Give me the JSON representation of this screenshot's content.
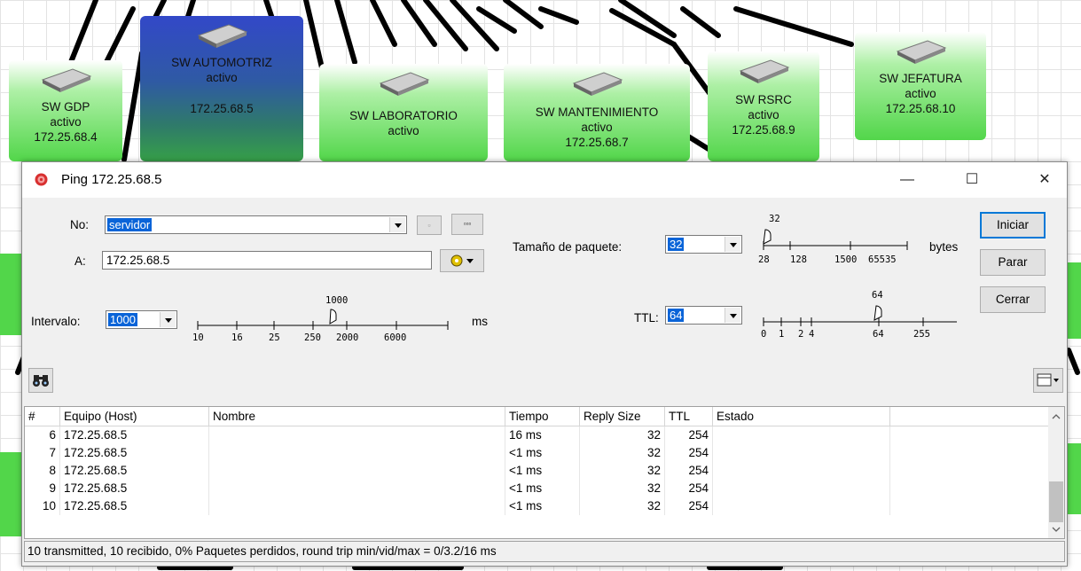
{
  "map": {
    "nodes": [
      {
        "id": "gdp",
        "name": "SW GDP",
        "status": "activo",
        "ip": "172.25.68.4",
        "selected": false
      },
      {
        "id": "automotriz",
        "name": "SW AUTOMOTRIZ",
        "status": "activo",
        "ip": "172.25.68.5",
        "selected": true
      },
      {
        "id": "laboratorio",
        "name": "SW LABORATORIO",
        "status": "activo",
        "ip": "",
        "selected": false
      },
      {
        "id": "mantenimiento",
        "name": "SW MANTENIMIENTO",
        "status": "activo",
        "ip": "172.25.68.7",
        "selected": false
      },
      {
        "id": "rsrc",
        "name": "SW RSRC",
        "status": "activo",
        "ip": "172.25.68.9",
        "selected": false
      },
      {
        "id": "jefatura",
        "name": "SW JEFATURA",
        "status": "activo",
        "ip": "172.25.68.10",
        "selected": false
      }
    ]
  },
  "dialog": {
    "title": "Ping 172.25.68.5",
    "window_controls": {
      "minimize": "—",
      "maximize": "☐",
      "close": "✕"
    },
    "no_label": "No:",
    "no_value": "servidor",
    "small_button": "▫",
    "dots_button": "▫▫▫",
    "a_label": "A:",
    "a_value": "172.25.68.5",
    "packet_label": "Tamaño de paquete:",
    "packet_value": "32",
    "packet_slider": {
      "current": "32",
      "ticks": [
        "28",
        "128",
        "1500",
        "65535"
      ],
      "unit": "bytes"
    },
    "interval_label": "Intervalo:",
    "interval_value": "1000",
    "interval_slider": {
      "current": "1000",
      "ticks": [
        "10",
        "16",
        "25",
        "250",
        "2000",
        "6000"
      ],
      "unit": "ms"
    },
    "ttl_label": "TTL:",
    "ttl_value": "64",
    "ttl_slider": {
      "current": "64",
      "ticks": [
        "0",
        "1",
        "2",
        "4",
        "64",
        "255"
      ]
    },
    "buttons": {
      "start": "Iniciar",
      "stop": "Parar",
      "close": "Cerrar"
    },
    "table": {
      "columns": [
        "#",
        "Equipo (Host)",
        "Nombre",
        "Tiempo",
        "Reply Size",
        "TTL",
        "Estado"
      ],
      "rows": [
        {
          "n": "6",
          "host": "172.25.68.5",
          "name": "",
          "time": "16 ms",
          "size": "32",
          "ttl": "254",
          "state": ""
        },
        {
          "n": "7",
          "host": "172.25.68.5",
          "name": "",
          "time": "<1 ms",
          "size": "32",
          "ttl": "254",
          "state": ""
        },
        {
          "n": "8",
          "host": "172.25.68.5",
          "name": "",
          "time": "<1 ms",
          "size": "32",
          "ttl": "254",
          "state": ""
        },
        {
          "n": "9",
          "host": "172.25.68.5",
          "name": "",
          "time": "<1 ms",
          "size": "32",
          "ttl": "254",
          "state": ""
        },
        {
          "n": "10",
          "host": "172.25.68.5",
          "name": "",
          "time": "<1 ms",
          "size": "32",
          "ttl": "254",
          "state": ""
        }
      ]
    },
    "status_text": "10 transmitted, 10 recibido, 0% Paquetes perdidos, round trip min/vid/max = 0/3.2/16 ms"
  },
  "colors": {
    "node_green": "#52d64a",
    "node_selected": "#3248c8",
    "selection": "#0a64d8",
    "ping_icon": "#d83030"
  }
}
